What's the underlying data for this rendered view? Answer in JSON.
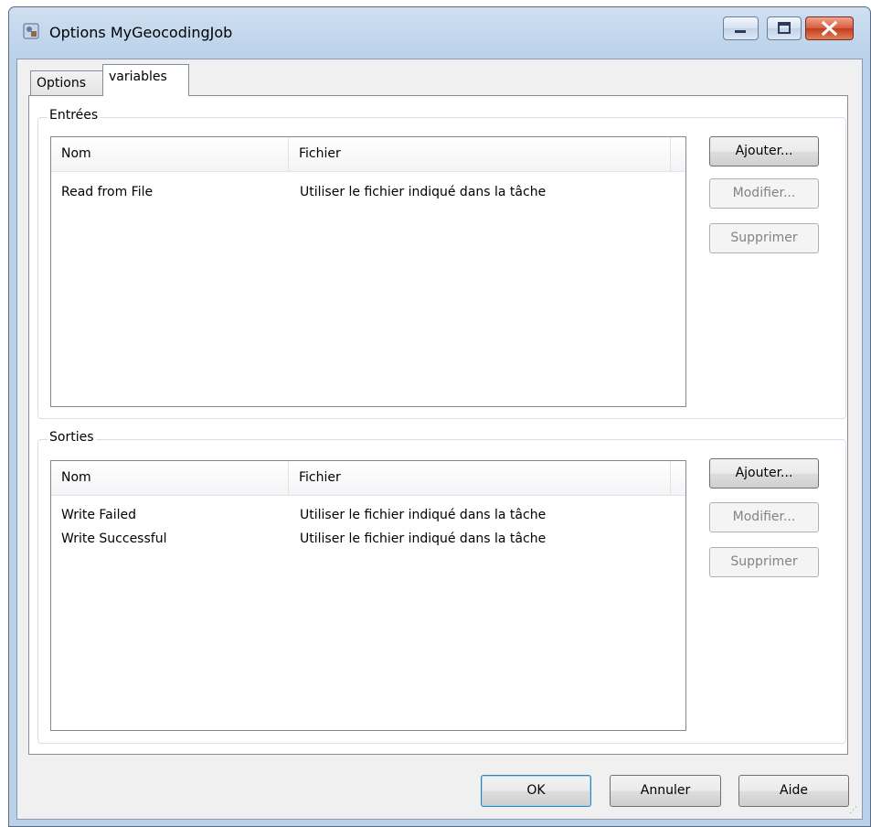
{
  "window": {
    "title": "Options MyGeocodingJob",
    "icon": "app-icon"
  },
  "tabs": [
    {
      "label": "Options",
      "selected": false
    },
    {
      "label": "variables",
      "selected": true
    }
  ],
  "entrees": {
    "label": "Entrées",
    "columns": [
      "Nom",
      "Fichier"
    ],
    "rows": [
      {
        "nom": "Read from File",
        "fichier": "Utiliser le fichier indiqué dans la tâche"
      }
    ],
    "buttons": {
      "add": "Ajouter...",
      "edit": "Modifier...",
      "delete": "Supprimer"
    }
  },
  "sorties": {
    "label": "Sorties",
    "columns": [
      "Nom",
      "Fichier"
    ],
    "rows": [
      {
        "nom": "Write Failed",
        "fichier": "Utiliser le fichier indiqué dans la tâche"
      },
      {
        "nom": "Write Successful",
        "fichier": "Utiliser le fichier indiqué dans la tâche"
      }
    ],
    "buttons": {
      "add": "Ajouter...",
      "edit": "Modifier...",
      "delete": "Supprimer"
    }
  },
  "footer": {
    "ok": "OK",
    "cancel": "Annuler",
    "help": "Aide"
  }
}
